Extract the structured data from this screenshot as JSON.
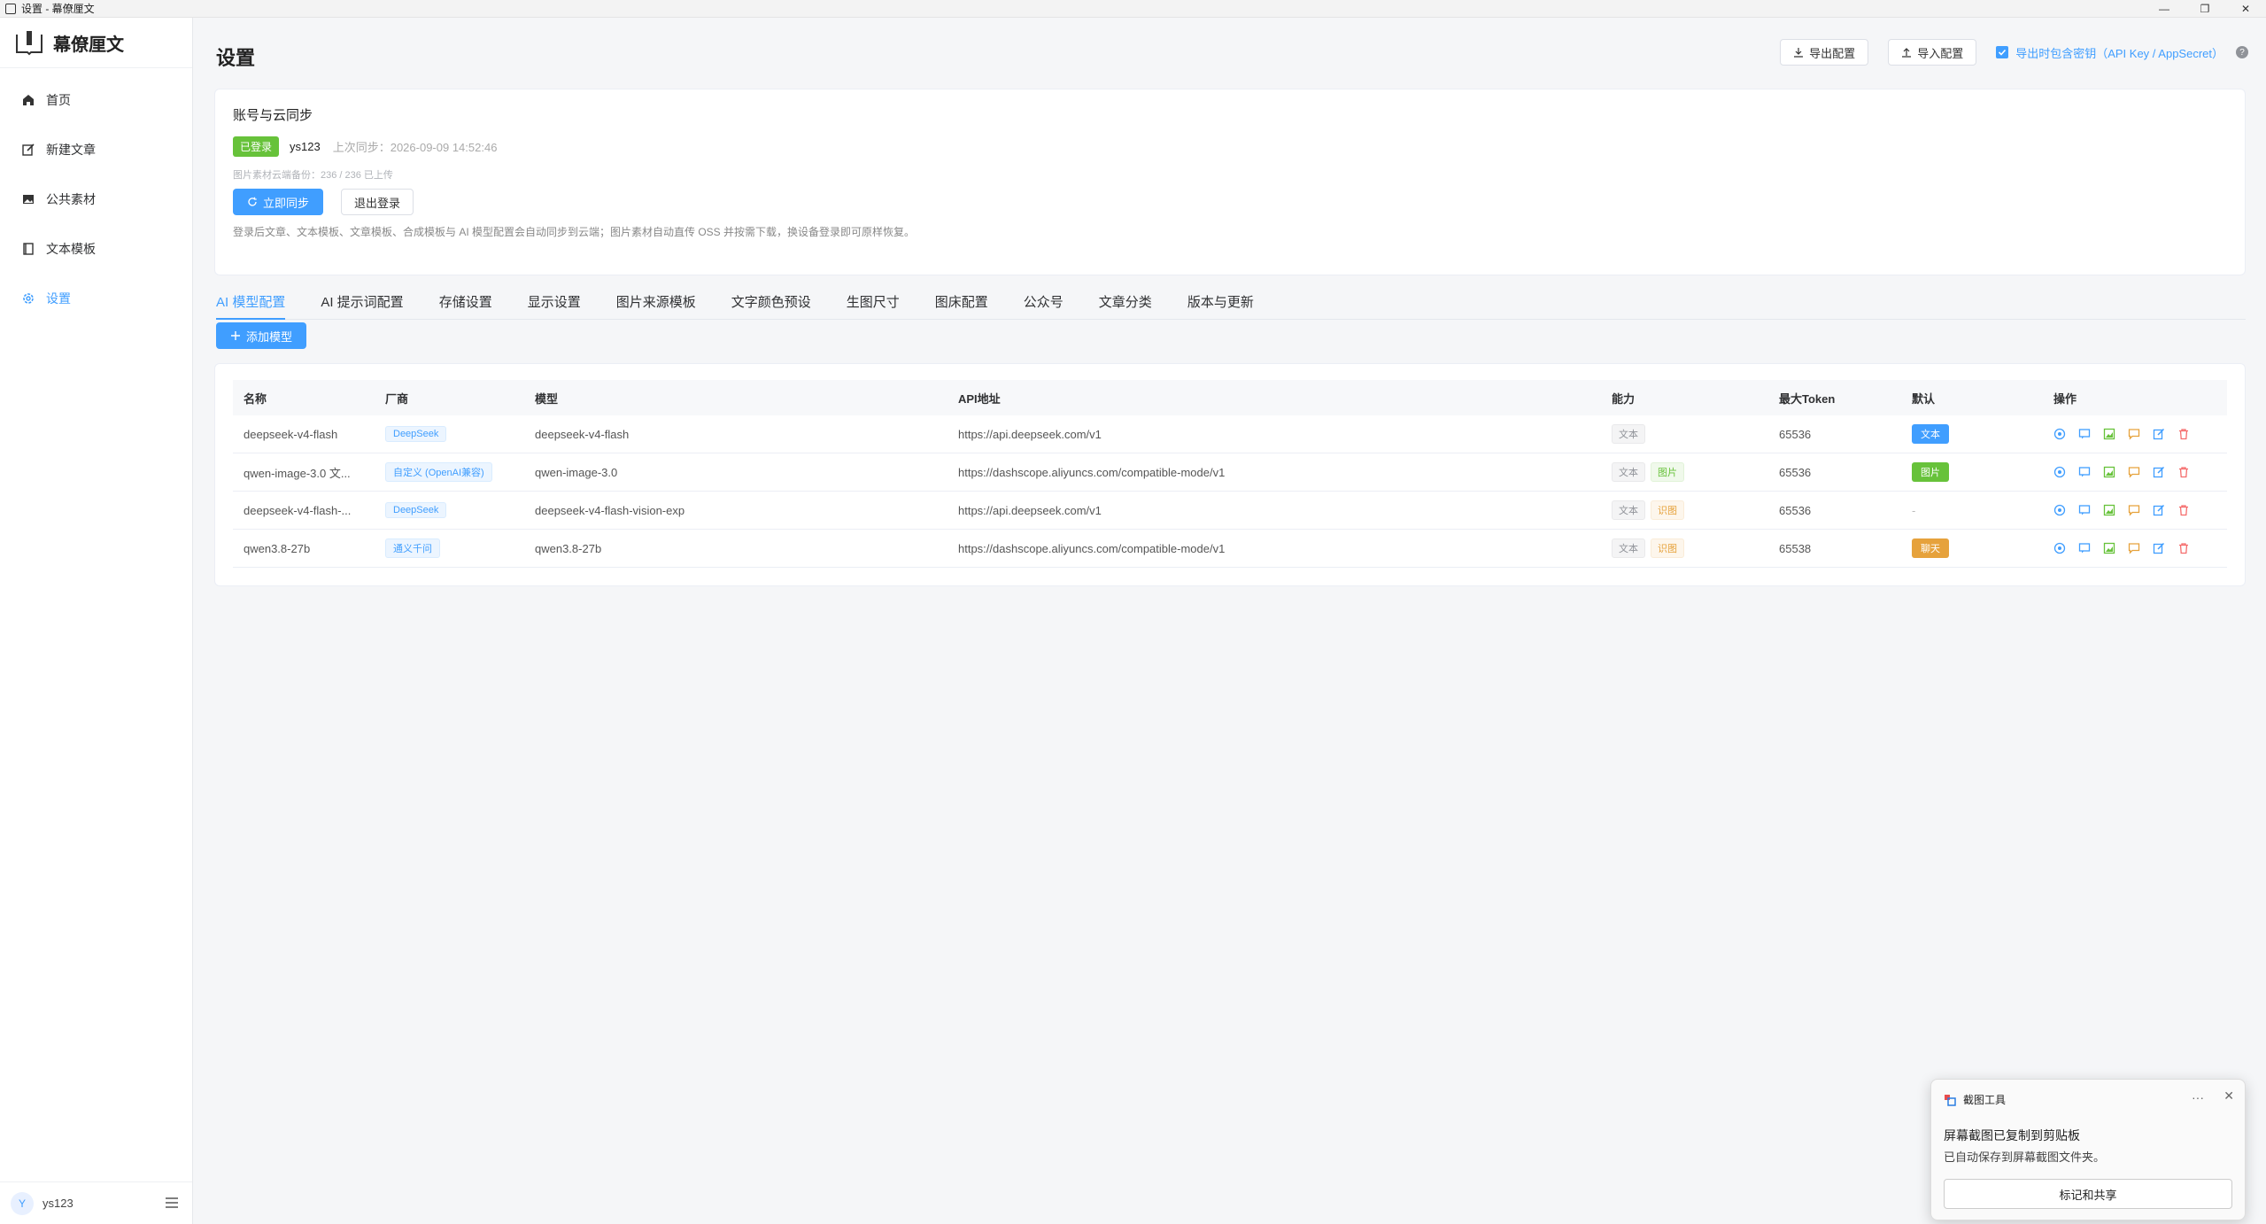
{
  "window": {
    "title": "设置 - 幕僚厘文"
  },
  "sidebar": {
    "brand": "幕僚厘文",
    "items": [
      {
        "label": "首页",
        "icon": "home-icon"
      },
      {
        "label": "新建文章",
        "icon": "edit-icon"
      },
      {
        "label": "公共素材",
        "icon": "image-icon"
      },
      {
        "label": "文本模板",
        "icon": "book-icon"
      },
      {
        "label": "设置",
        "icon": "gear-icon"
      }
    ],
    "user": {
      "avatar": "Y",
      "name": "ys123"
    }
  },
  "header": {
    "title": "设置",
    "export_label": "导出配置",
    "import_label": "导入配置",
    "include_secret_label": "导出时包含密钥（API Key / AppSecret）",
    "include_secret_checked": true
  },
  "account": {
    "title": "账号与云同步",
    "status_badge": "已登录",
    "username": "ys123",
    "last_sync": "上次同步：2026-09-09 14:52:46",
    "backup_note": "图片素材云端备份：236 / 236 已上传",
    "sync_label": "立即同步",
    "logout_label": "退出登录",
    "description": "登录后文章、文本模板、文章模板、合成模板与 AI 模型配置会自动同步到云端；图片素材自动直传 OSS 并按需下载，换设备登录即可原样恢复。"
  },
  "tabs": [
    "AI 模型配置",
    "AI 提示词配置",
    "存储设置",
    "显示设置",
    "图片来源模板",
    "文字颜色预设",
    "生图尺寸",
    "图床配置",
    "公众号",
    "文章分类",
    "版本与更新"
  ],
  "active_tab": 0,
  "add_model_label": "添加模型",
  "table": {
    "headers": [
      "名称",
      "厂商",
      "模型",
      "API地址",
      "能力",
      "最大Token",
      "默认",
      "操作"
    ],
    "rows": [
      {
        "name": "deepseek-v4-flash",
        "vendor": "DeepSeek",
        "model": "deepseek-v4-flash",
        "api": "https://api.deepseek.com/v1",
        "caps": [
          "文本"
        ],
        "max_token": "65536",
        "default": "文本",
        "default_color": "#409eff"
      },
      {
        "name": "qwen-image-3.0 文...",
        "vendor": "自定义 (OpenAI兼容)",
        "model": "qwen-image-3.0",
        "api": "https://dashscope.aliyuncs.com/compatible-mode/v1",
        "caps": [
          "文本",
          "图片"
        ],
        "max_token": "65536",
        "default": "图片",
        "default_color": "#67c23a"
      },
      {
        "name": "deepseek-v4-flash-...",
        "vendor": "DeepSeek",
        "model": "deepseek-v4-flash-vision-exp",
        "api": "https://api.deepseek.com/v1",
        "caps": [
          "文本",
          "识图"
        ],
        "max_token": "65536",
        "default": "-",
        "default_color": ""
      },
      {
        "name": "qwen3.8-27b",
        "vendor": "通义千问",
        "model": "qwen3.8-27b",
        "api": "https://dashscope.aliyuncs.com/compatible-mode/v1",
        "caps": [
          "文本",
          "识图"
        ],
        "max_token": "65538",
        "default": "聊天",
        "default_color": "#e6a23c"
      }
    ]
  },
  "toast": {
    "app": "截图工具",
    "title": "屏幕截图已复制到剪贴板",
    "subtitle": "已自动保存到屏幕截图文件夹。",
    "action": "标记和共享"
  }
}
